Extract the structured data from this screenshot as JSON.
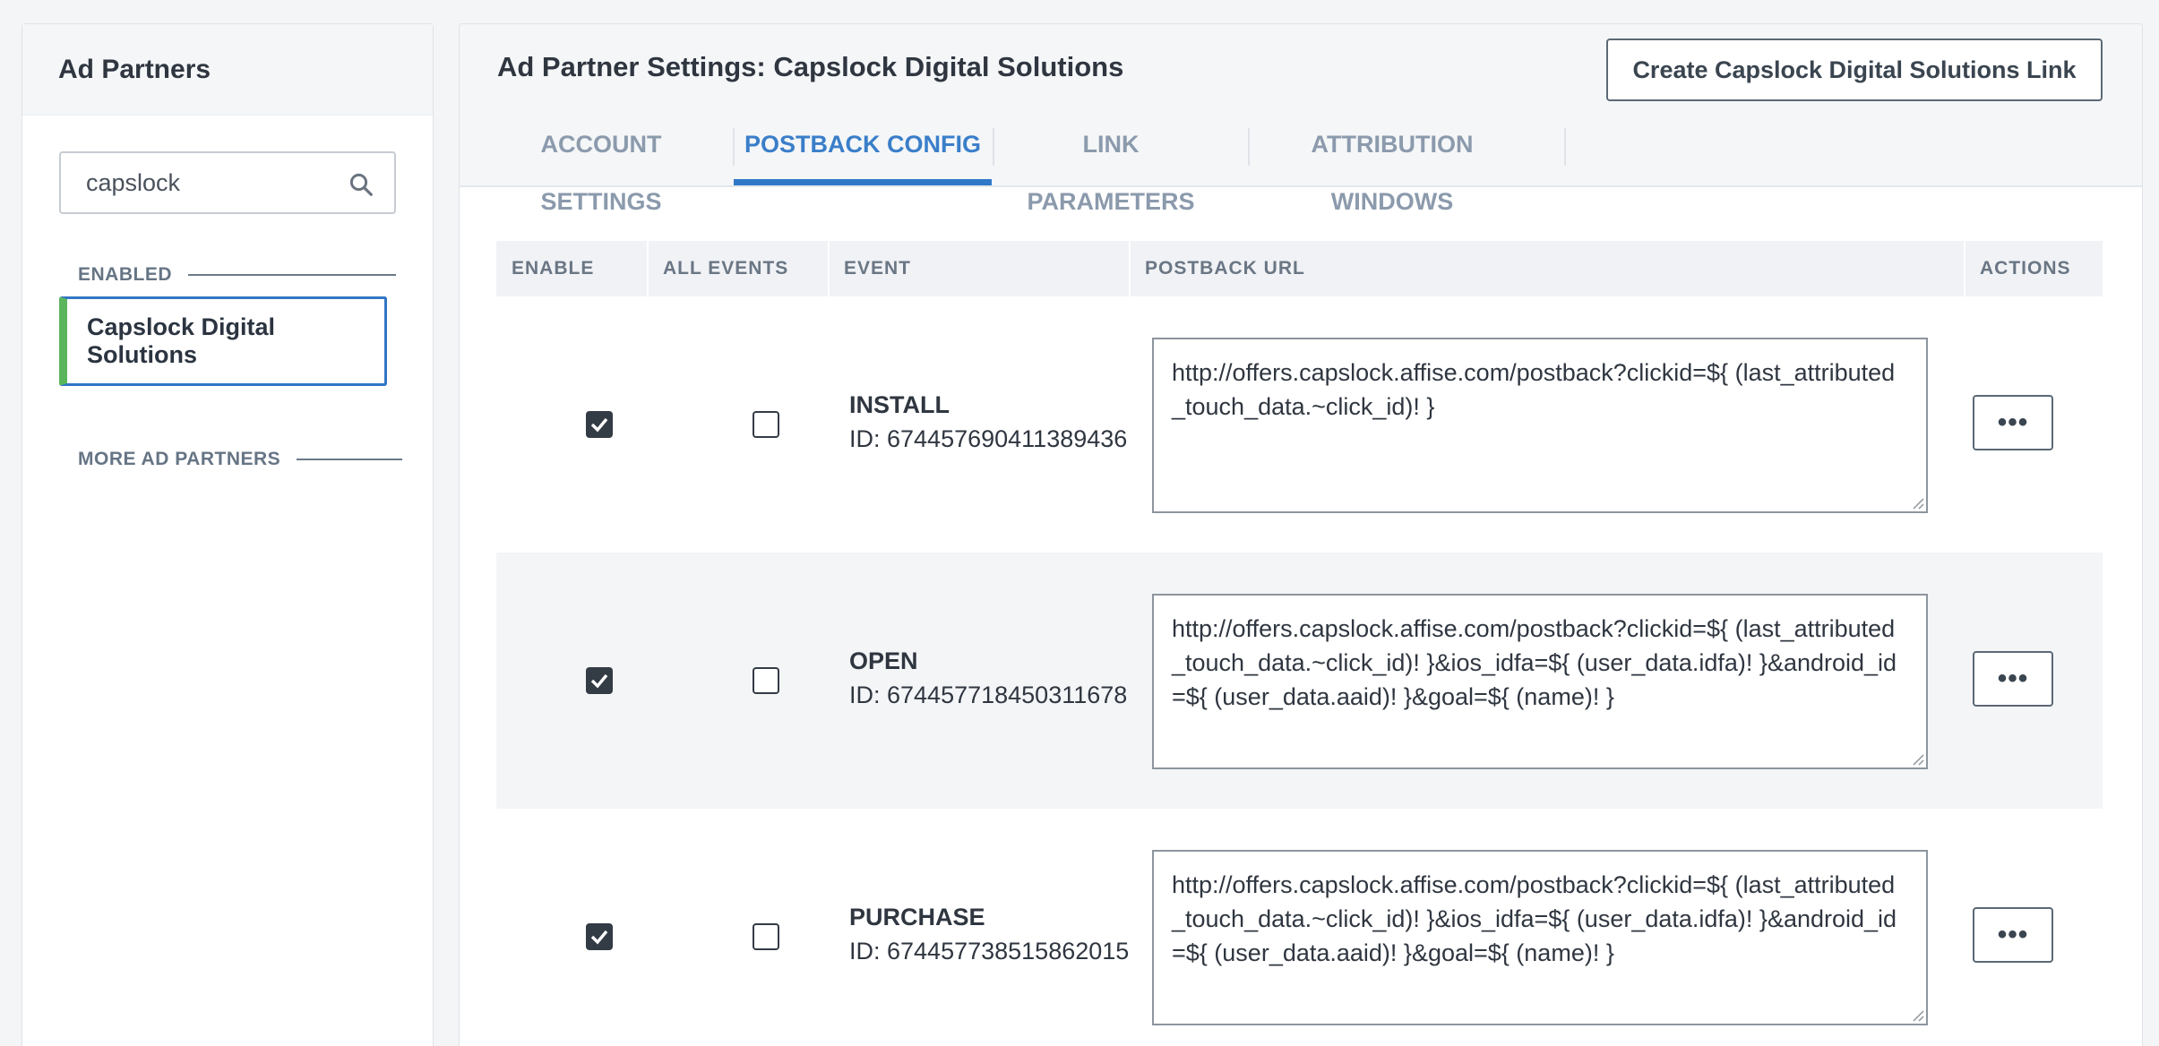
{
  "sidebar": {
    "title": "Ad Partners",
    "search_value": "capslock",
    "enabled_label": "ENABLED",
    "more_label": "MORE AD PARTNERS",
    "partners": [
      {
        "name": "Capslock Digital Solutions",
        "selected": true
      }
    ]
  },
  "main": {
    "title": "Ad Partner Settings: Capslock Digital Solutions",
    "create_button": "Create Capslock Digital Solutions Link",
    "tabs": [
      {
        "label": "ACCOUNT SETTINGS",
        "active": false
      },
      {
        "label": "POSTBACK CONFIG",
        "active": true
      },
      {
        "label": "LINK PARAMETERS",
        "active": false
      },
      {
        "label": "ATTRIBUTION WINDOWS",
        "active": false
      }
    ],
    "table": {
      "headers": [
        "ENABLE",
        "ALL EVENTS",
        "EVENT",
        "POSTBACK URL",
        "ACTIONS"
      ],
      "rows": [
        {
          "enable": true,
          "all_events": false,
          "event": "INSTALL",
          "id": "ID: 674457690411389436",
          "url": "http://offers.capslock.affise.com/postback?clickid=${ (last_attributed_touch_data.~click_id)! }",
          "action_label": "•••"
        },
        {
          "enable": true,
          "all_events": false,
          "event": "OPEN",
          "id": "ID: 674457718450311678",
          "url": "http://offers.capslock.affise.com/postback?clickid=${ (last_attributed_touch_data.~click_id)! }&ios_idfa=${ (user_data.idfa)! }&android_id=${ (user_data.aaid)! }&goal=${ (name)! }",
          "action_label": "•••"
        },
        {
          "enable": true,
          "all_events": false,
          "event": "PURCHASE",
          "id": "ID: 674457738515862015",
          "url": "http://offers.capslock.affise.com/postback?clickid=${ (last_attributed_touch_data.~click_id)! }&ios_idfa=${ (user_data.idfa)! }&android_id=${ (user_data.aaid)! }&goal=${ (name)! }",
          "action_label": "•••"
        }
      ]
    }
  },
  "colors": {
    "accent": "#2f78c8",
    "enabled_green": "#5bb55d",
    "text": "#2f3640",
    "muted": "#8b9aac"
  },
  "icons": {
    "search": "search-icon",
    "checkbox": "checkbox-icon",
    "more": "more-actions-icon"
  }
}
